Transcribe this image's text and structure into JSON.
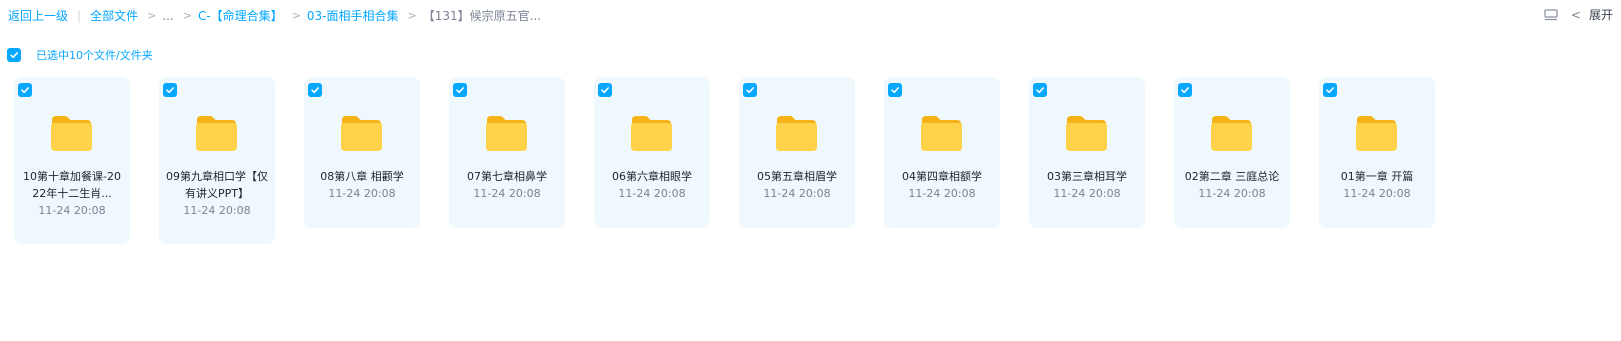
{
  "breadcrumb": {
    "back": "返回上一级",
    "all_files": "全部文件",
    "ellipsis": "...",
    "level1": "C-【命理合集】",
    "level2": "03-面相手相合集",
    "current": "【131】候宗原五官..."
  },
  "toolbar": {
    "expand_label": "展开",
    "list_icon": "list-view-icon",
    "chevron_icon": "chevron-left-icon"
  },
  "selection": {
    "text": "已选中10个文件/文件夹"
  },
  "colors": {
    "accent": "#06a7ff",
    "card_bg": "#eff8fd",
    "folder_yellow": "#ffc63a"
  },
  "folders": [
    {
      "name": "10第十章加餐课-2022年十二生肖...",
      "time": "11-24 20:08",
      "selected": true
    },
    {
      "name": "09第九章相口学【仅有讲义PPT】",
      "time": "11-24 20:08",
      "selected": true
    },
    {
      "name": "08第八章 相颧学",
      "time": "11-24 20:08",
      "selected": true
    },
    {
      "name": "07第七章相鼻学",
      "time": "11-24 20:08",
      "selected": true
    },
    {
      "name": "06第六章相眼学",
      "time": "11-24 20:08",
      "selected": true
    },
    {
      "name": "05第五章相眉学",
      "time": "11-24 20:08",
      "selected": true
    },
    {
      "name": "04第四章相额学",
      "time": "11-24 20:08",
      "selected": true
    },
    {
      "name": "03第三章相耳学",
      "time": "11-24 20:08",
      "selected": true
    },
    {
      "name": "02第二章 三庭总论",
      "time": "11-24 20:08",
      "selected": true
    },
    {
      "name": "01第一章 开篇",
      "time": "11-24 20:08",
      "selected": true
    }
  ]
}
